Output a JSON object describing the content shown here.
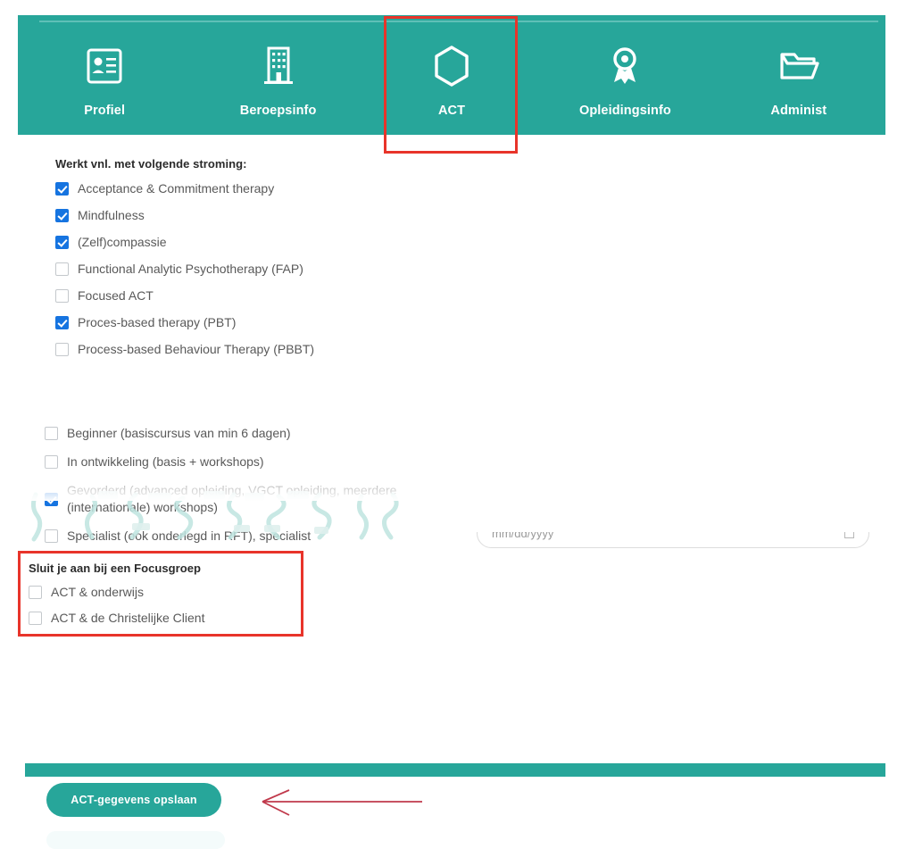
{
  "colors": {
    "teal": "#27a69a",
    "teal_rule": "#5fc0b7",
    "annotation_red": "#e8342a",
    "arrow_red": "#c0394b",
    "checkbox_blue": "#1674e0",
    "label_grey": "#595959",
    "heading_dark": "#2b2b2b"
  },
  "nav": {
    "items": [
      {
        "label": "Profiel",
        "icon": "id-card-icon",
        "active": false
      },
      {
        "label": "Beroepsinfo",
        "icon": "building-icon",
        "active": false
      },
      {
        "label": "ACT",
        "icon": "hexagon-icon",
        "active": true
      },
      {
        "label": "Opleidingsinfo",
        "icon": "award-icon",
        "active": false
      },
      {
        "label": "Administ",
        "icon": "folder-icon",
        "active": false
      }
    ]
  },
  "form": {
    "stroming": {
      "title": "Werkt vnl. met volgende stroming:",
      "options": [
        {
          "label": "Acceptance & Commitment therapy",
          "checked": true
        },
        {
          "label": "Mindfulness",
          "checked": true
        },
        {
          "label": "(Zelf)compassie",
          "checked": true
        },
        {
          "label": "Functional Analytic Psychotherapy (FAP)",
          "checked": false
        },
        {
          "label": "Focused ACT",
          "checked": false
        },
        {
          "label": "Proces-based therapy (PBT)",
          "checked": true
        },
        {
          "label": "Process-based Behaviour Therapy (PBBT)",
          "checked": false
        }
      ]
    },
    "ervaring": {
      "options": [
        {
          "label": "Beginner (basiscursus van min 6 dagen)",
          "checked": false
        },
        {
          "label": "In ontwikkeling (basis + workshops)",
          "checked": false
        },
        {
          "label": "Gevorderd (advanced opleiding, VGCT opleiding, meerdere (internationale) workshops)",
          "checked": true
        },
        {
          "label": "Specialist (ook onderlegd in RFT), specialist",
          "checked": false
        }
      ]
    },
    "date_field": {
      "placeholder": "mm/dd/yyyy",
      "value": ""
    },
    "focusgroep": {
      "title": "Sluit je aan bij een Focusgroep",
      "options": [
        {
          "label": "ACT & onderwijs",
          "checked": false
        },
        {
          "label": "ACT & de Christelijke Client",
          "checked": false
        }
      ]
    },
    "save_button_label": "ACT-gegevens opslaan"
  }
}
